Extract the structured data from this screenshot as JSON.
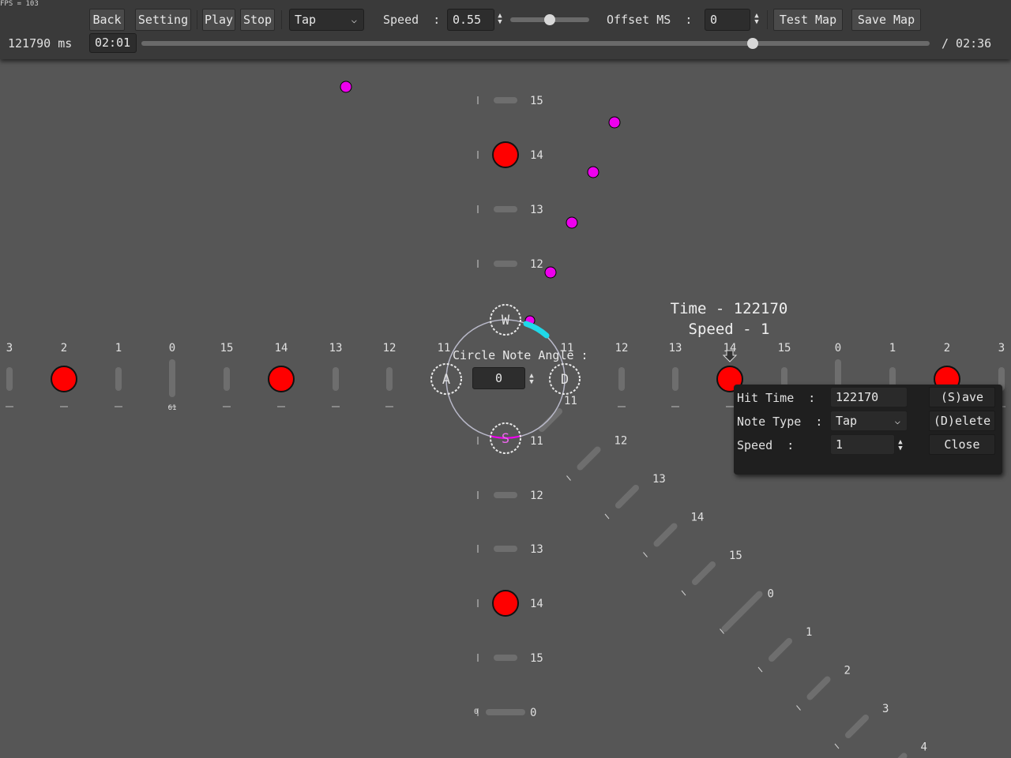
{
  "fps_text": "FPS = 103",
  "toolbar": {
    "back": "Back",
    "setting": "Setting",
    "play": "Play",
    "stop": "Stop",
    "note_type_selected": "Tap",
    "speed_label": "Speed  :",
    "speed_value": "0.55",
    "speed_slider_fraction": 0.5,
    "offset_label": "Offset MS  :",
    "offset_value": "0",
    "test_map": "Test Map",
    "save_map": "Save Map"
  },
  "timeline": {
    "current_ms": "121790 ms",
    "current_time": "02:01",
    "total_time": "/ 02:36",
    "progress_fraction": 0.776
  },
  "preview": {
    "time_line": "Time - 122170",
    "speed_line": "Speed - 1"
  },
  "circle_control": {
    "label": "Circle Note Angle :",
    "angle_value": "0",
    "key_up": "W",
    "key_left": "A",
    "key_right": "D",
    "key_down": "S"
  },
  "note_panel": {
    "hit_time_label": "Hit Time  :",
    "hit_time_value": "122170",
    "note_type_label": "Note Type  :",
    "note_type_value": "Tap",
    "speed_label": "Speed  :",
    "speed_value": "1",
    "save_button": "(S)ave",
    "delete_button": "(D)elete",
    "close_button": "Close"
  },
  "lanes": {
    "horizontal_labels": [
      "3",
      "2",
      "1",
      "0",
      "15",
      "14",
      "13",
      "12",
      "11",
      "11",
      "12",
      "13",
      "14",
      "15",
      "0",
      "1",
      "2",
      "3"
    ],
    "marker_61": "61",
    "vertical_up_labels": [
      "15",
      "14",
      "13",
      "12",
      "11"
    ],
    "vertical_down_labels": [
      "11",
      "12",
      "13",
      "14",
      "15",
      "0"
    ],
    "vertical_down_marker": "0",
    "diagonal_labels": [
      "11",
      "12",
      "13",
      "14",
      "15",
      "0",
      "1",
      "2",
      "3",
      "4"
    ]
  },
  "colors": {
    "background": "#565656",
    "toolbar": "#3a3a3a",
    "note_red": "#ff0000",
    "note_magenta": "#ee00ee",
    "arc_cyan": "#20d8e8"
  }
}
